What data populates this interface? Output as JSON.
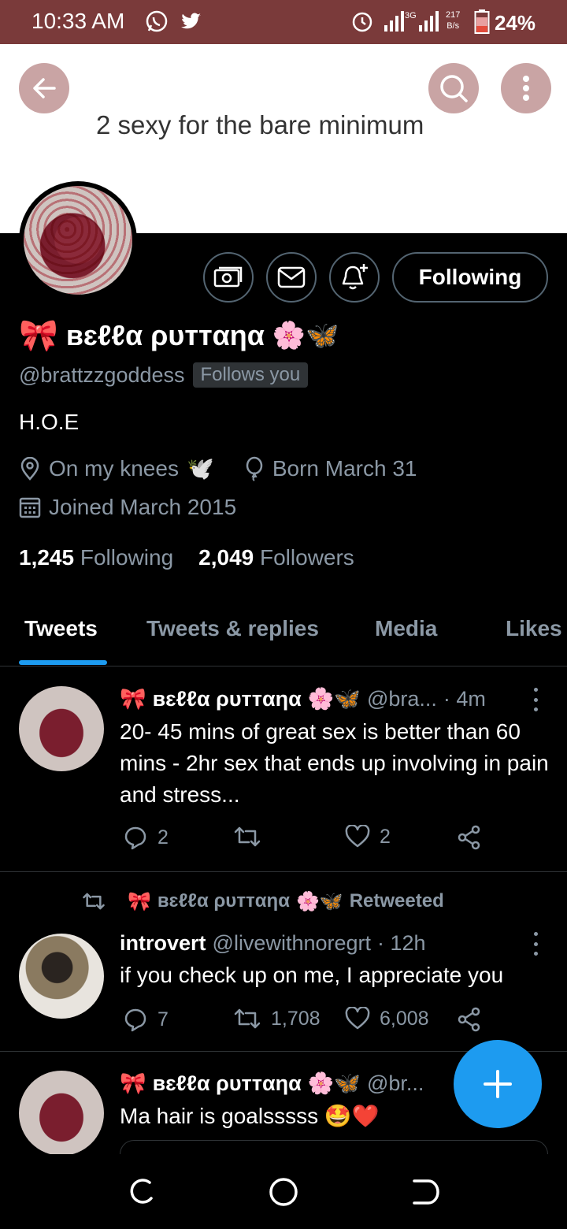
{
  "status_bar": {
    "time": "10:33 AM",
    "network_speed_value": "217",
    "network_speed_unit": "B/s",
    "network_label": "3G",
    "battery": "24%"
  },
  "header": {
    "title": "2 sexy for the bare minimum"
  },
  "profile": {
    "display_name": "ʙɛℓℓα ρυттαηα",
    "name_emoji_left": "🎀",
    "name_emoji_right": "🌸🦋",
    "handle": "@brattzzgoddess",
    "follows_you": "Follows you",
    "bio": "H.O.E",
    "location": "On my knees",
    "location_emoji": "🕊️",
    "birthday": "Born March 31",
    "joined": "Joined March 2015",
    "following_count": "1,245",
    "following_label": "Following",
    "followers_count": "2,049",
    "followers_label": "Followers",
    "following_button": "Following"
  },
  "tabs": [
    {
      "label": "Tweets"
    },
    {
      "label": "Tweets & replies"
    },
    {
      "label": "Media"
    },
    {
      "label": "Likes"
    }
  ],
  "tweets": [
    {
      "name": "ʙɛℓℓα ρυттαηα",
      "handle": "@bra...",
      "time": "· 4m",
      "text": "20- 45 mins of great sex is better than 60 mins - 2hr sex that ends up involving in pain and stress...",
      "replies": "2",
      "retweets": "",
      "likes": "2"
    },
    {
      "retweeted_by": "ʙɛℓℓα ρυттαηα",
      "retweeted_label": "Retweeted",
      "name": "introvert",
      "handle": "@livewithnoregrt",
      "time": "· 12h",
      "text": "if you check up on me, I appreciate you",
      "replies": "7",
      "retweets": "1,708",
      "likes": "6,008"
    },
    {
      "name": "ʙɛℓℓα ρυттαηα",
      "handle": "@br...",
      "text": "Ma hair is goalsssss",
      "text_emoji": "🤩❤️"
    }
  ],
  "colors": {
    "status_bar": "#7a3a3a",
    "accent": "#1d9bf0",
    "banner": "#ffffff"
  }
}
